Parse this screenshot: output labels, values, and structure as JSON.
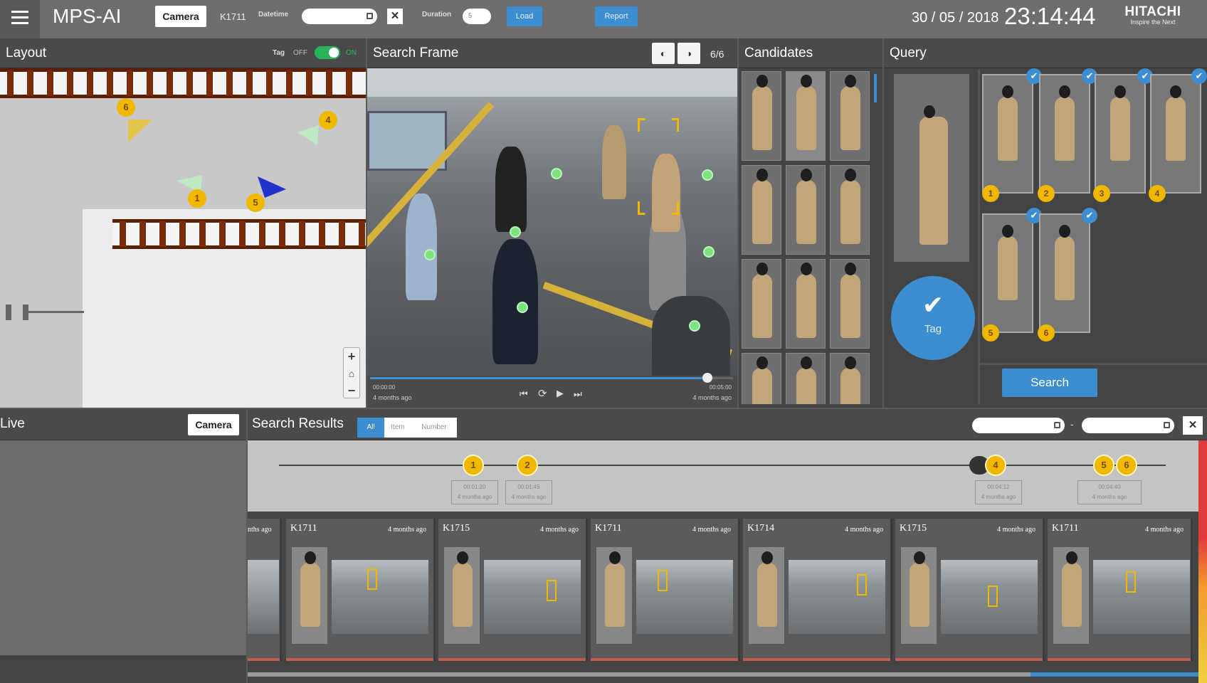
{
  "app": {
    "title": "MPS-AI",
    "camera_button": "Camera",
    "camera_id": "K1711",
    "datetime_label": "Datetime",
    "datetime_value": "",
    "duration_label": "Duration",
    "duration_value": "5",
    "load_button": "Load",
    "report_button": "Report",
    "close_label": "✕",
    "date": "30 / 05 / 2018",
    "time": "23:14:44",
    "brand": "HITACHI",
    "brand_tagline": "Inspire the Next"
  },
  "layout": {
    "title": "Layout",
    "tag_label": "Tag",
    "off_label": "OFF",
    "on_label": "ON",
    "tag_enabled": true,
    "markers": [
      "6",
      "4",
      "1",
      "5"
    ],
    "zoom_in": "+",
    "home": "⌂",
    "zoom_out": "−"
  },
  "search_frame": {
    "title": "Search Frame",
    "frame_counter": "6/6",
    "start_time": "00:00:00",
    "start_ago": "4 months ago",
    "end_time": "00:05:00",
    "end_ago": "4 months ago",
    "overlay_text": "",
    "playback_progress": 0.93
  },
  "candidates": {
    "title": "Candidates"
  },
  "query": {
    "title": "Query",
    "tag_button": "Tag",
    "thumb_numbers": [
      "1",
      "2",
      "3",
      "4",
      "5",
      "6"
    ],
    "search_button": "Search"
  },
  "live": {
    "title": "Live",
    "camera_button": "Camera"
  },
  "results": {
    "title": "Search Results",
    "filters": [
      "All",
      "Item",
      "Number"
    ],
    "active_filter": "All",
    "range_separator": "-",
    "close_label": "✕",
    "timeline_markers": [
      "1",
      "2",
      "4",
      "5",
      "6"
    ],
    "timeline_labels": [
      {
        "time": "00:01:20",
        "ago": "4 months ago"
      },
      {
        "time": "00:01:45",
        "ago": "4 months ago"
      },
      {
        "time": "00:04:12",
        "ago": "4 months ago"
      },
      {
        "time": "00:04:40",
        "ago": "4 months ago"
      }
    ],
    "first_card_ago": "nths ago",
    "cards": [
      {
        "camera": "K1711",
        "ago": "4 months ago"
      },
      {
        "camera": "K1715",
        "ago": "4 months ago"
      },
      {
        "camera": "K1711",
        "ago": "4 months ago"
      },
      {
        "camera": "K1714",
        "ago": "4 months ago"
      },
      {
        "camera": "K1715",
        "ago": "4 months ago"
      },
      {
        "camera": "K1711",
        "ago": "4 months ago"
      }
    ]
  },
  "colors": {
    "accent": "#3d8ed1",
    "marker": "#f0b800",
    "toggle_on": "#29b35a",
    "rail": "#7a2b08"
  }
}
